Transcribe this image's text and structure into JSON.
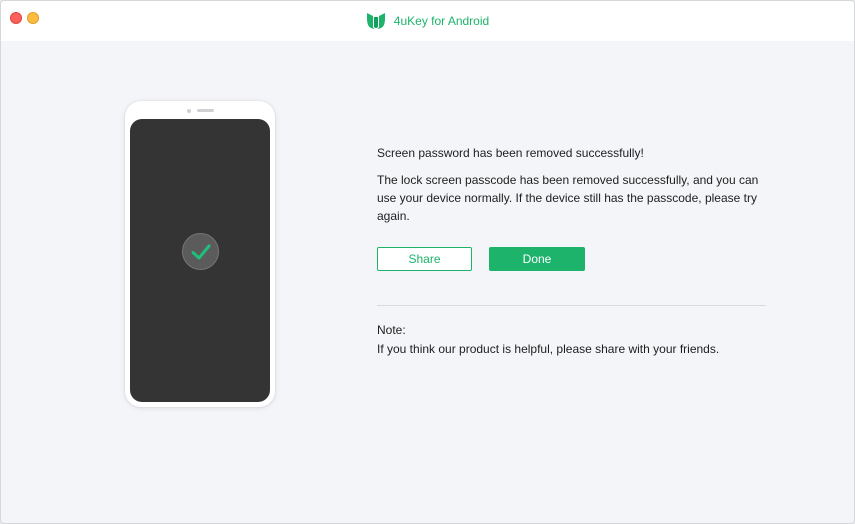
{
  "window": {
    "title": "4uKey for Android",
    "logo_icon": "4ukey-logo-icon",
    "accent_color": "#1db36b"
  },
  "phone": {
    "status_icon": "checkmark-icon"
  },
  "result": {
    "heading": "Screen password has been removed successfully!",
    "description": "The lock screen passcode has been removed successfully, and you can use your device normally. If the device still has the passcode, please try again."
  },
  "buttons": {
    "share_label": "Share",
    "done_label": "Done"
  },
  "note": {
    "label": "Note:",
    "text": "If you think our product is helpful, please share with your friends."
  }
}
